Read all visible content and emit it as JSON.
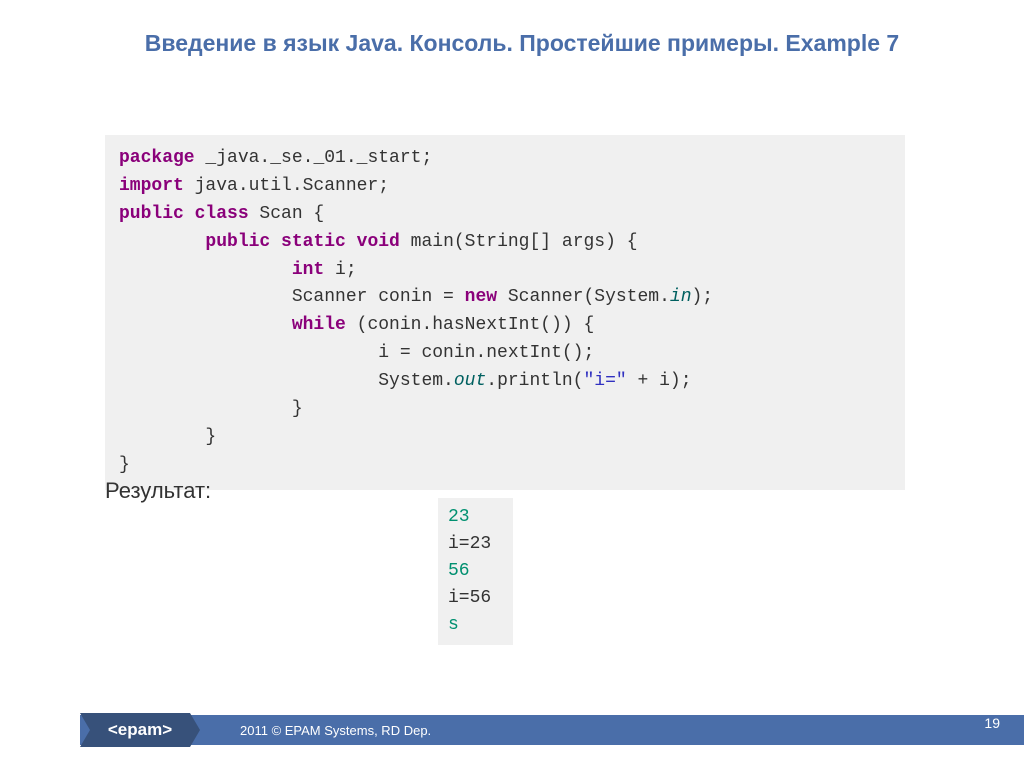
{
  "title": "Введение в язык Java. Консоль. Простейшие примеры. Example 7",
  "code": {
    "tokens": [
      {
        "t": "package",
        "c": "kw"
      },
      {
        "t": " _java._se._01._start;\n"
      },
      {
        "t": "import",
        "c": "kw"
      },
      {
        "t": " java.util.Scanner;\n"
      },
      {
        "t": "public class",
        "c": "kw"
      },
      {
        "t": " Scan {\n"
      },
      {
        "t": "        "
      },
      {
        "t": "public static void",
        "c": "kw"
      },
      {
        "t": " main(String[] args) {\n"
      },
      {
        "t": "                "
      },
      {
        "t": "int",
        "c": "kw"
      },
      {
        "t": " i;\n"
      },
      {
        "t": "                Scanner conin = "
      },
      {
        "t": "new",
        "c": "kw"
      },
      {
        "t": " Scanner(System."
      },
      {
        "t": "in",
        "c": "field"
      },
      {
        "t": ");\n"
      },
      {
        "t": "                "
      },
      {
        "t": "while",
        "c": "kw"
      },
      {
        "t": " (conin.hasNextInt()) {\n"
      },
      {
        "t": "                        i = conin.nextInt();\n"
      },
      {
        "t": "                        System."
      },
      {
        "t": "out",
        "c": "field"
      },
      {
        "t": ".println("
      },
      {
        "t": "\"i=\"",
        "c": "str"
      },
      {
        "t": " + i);\n"
      },
      {
        "t": "                }\n"
      },
      {
        "t": "        }\n"
      },
      {
        "t": "}"
      }
    ]
  },
  "result_label": "Результат:",
  "output": [
    {
      "v": "23",
      "c": "in"
    },
    {
      "v": "i=23"
    },
    {
      "v": "56",
      "c": "in"
    },
    {
      "v": "i=56"
    },
    {
      "v": "s",
      "c": "in"
    }
  ],
  "footer": {
    "copyright": "2011 © EPAM Systems, RD Dep.",
    "logo_text": "<epam>",
    "page": "19"
  },
  "colors": {
    "brand": "#4a6ea9"
  }
}
